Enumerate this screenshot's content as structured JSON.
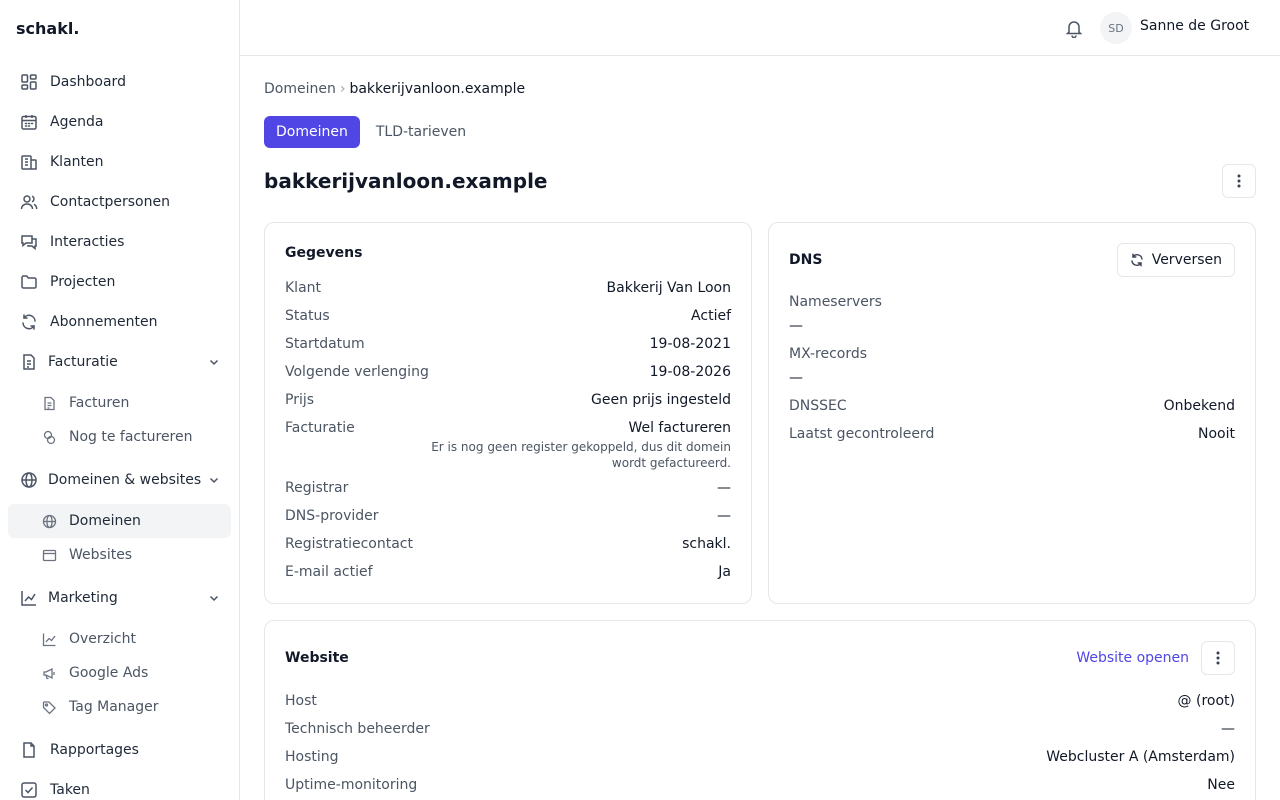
{
  "app": {
    "logo": "schakl."
  },
  "sidebar": {
    "items": [
      {
        "label": "Dashboard",
        "icon": "dashboard-icon"
      },
      {
        "label": "Agenda",
        "icon": "calendar-icon"
      },
      {
        "label": "Klanten",
        "icon": "building-icon"
      },
      {
        "label": "Contactpersonen",
        "icon": "users-icon"
      },
      {
        "label": "Interacties",
        "icon": "chat-icon"
      },
      {
        "label": "Projecten",
        "icon": "folder-icon"
      },
      {
        "label": "Abonnementen",
        "icon": "refresh-icon"
      }
    ],
    "facturatie": {
      "label": "Facturatie",
      "icon": "document-icon",
      "sub": [
        "Facturen",
        "Nog te factureren"
      ]
    },
    "domeinen": {
      "label": "Domeinen & websites",
      "icon": "globe-icon",
      "sub": [
        "Domeinen",
        "Websites"
      ],
      "active_sub": "Domeinen"
    },
    "marketing": {
      "label": "Marketing",
      "icon": "chart-icon",
      "sub": [
        "Overzicht",
        "Google Ads",
        "Tag Manager"
      ]
    },
    "bottom": [
      {
        "label": "Rapportages",
        "icon": "file-icon"
      },
      {
        "label": "Taken",
        "icon": "check-square-icon"
      }
    ]
  },
  "header": {
    "avatar_initials": "SD",
    "user_name": "Sanne de Groot"
  },
  "breadcrumb": {
    "parent": "Domeinen",
    "separator": "›",
    "current": "bakkerijvanloon.example"
  },
  "tabs": [
    {
      "label": "Domeinen",
      "active": true
    },
    {
      "label": "TLD-tarieven",
      "active": false
    }
  ],
  "page": {
    "title": "bakkerijvanloon.example"
  },
  "gegevens": {
    "title": "Gegevens",
    "rows_top": [
      {
        "key": "Klant",
        "value": "Bakkerij Van Loon"
      },
      {
        "key": "Status",
        "value": "Actief"
      },
      {
        "key": "Startdatum",
        "value": "19-08-2021"
      },
      {
        "key": "Volgende verlenging",
        "value": "19-08-2026"
      },
      {
        "key": "Prijs",
        "value": "Geen prijs ingesteld"
      },
      {
        "key": "Facturatie",
        "value": "Wel factureren"
      }
    ],
    "facturatie_note": "Er is nog geen register gekoppeld, dus dit domein wordt gefactureerd.",
    "rows_bottom": [
      {
        "key": "Registrar",
        "value": "—"
      },
      {
        "key": "DNS-provider",
        "value": "—"
      },
      {
        "key": "Registratiecontact",
        "value": "schakl."
      },
      {
        "key": "E-mail actief",
        "value": "Ja"
      }
    ]
  },
  "dns": {
    "title": "DNS",
    "refresh_label": "Verversen",
    "nameservers_label": "Nameservers",
    "nameservers_value": "—",
    "mx_label": "MX-records",
    "mx_value": "—",
    "rows": [
      {
        "key": "DNSSEC",
        "value": "Onbekend"
      },
      {
        "key": "Laatst gecontroleerd",
        "value": "Nooit"
      }
    ]
  },
  "website": {
    "title": "Website",
    "open_label": "Website openen",
    "rows": [
      {
        "key": "Host",
        "value": "@ (root)"
      },
      {
        "key": "Technisch beheerder",
        "value": "—"
      },
      {
        "key": "Hosting",
        "value": "Webcluster A (Amsterdam)"
      },
      {
        "key": "Uptime-monitoring",
        "value": "Nee"
      }
    ]
  },
  "colors": {
    "accent": "#4f46e5",
    "border": "#e5e7eb",
    "muted_text": "#4b5563"
  }
}
